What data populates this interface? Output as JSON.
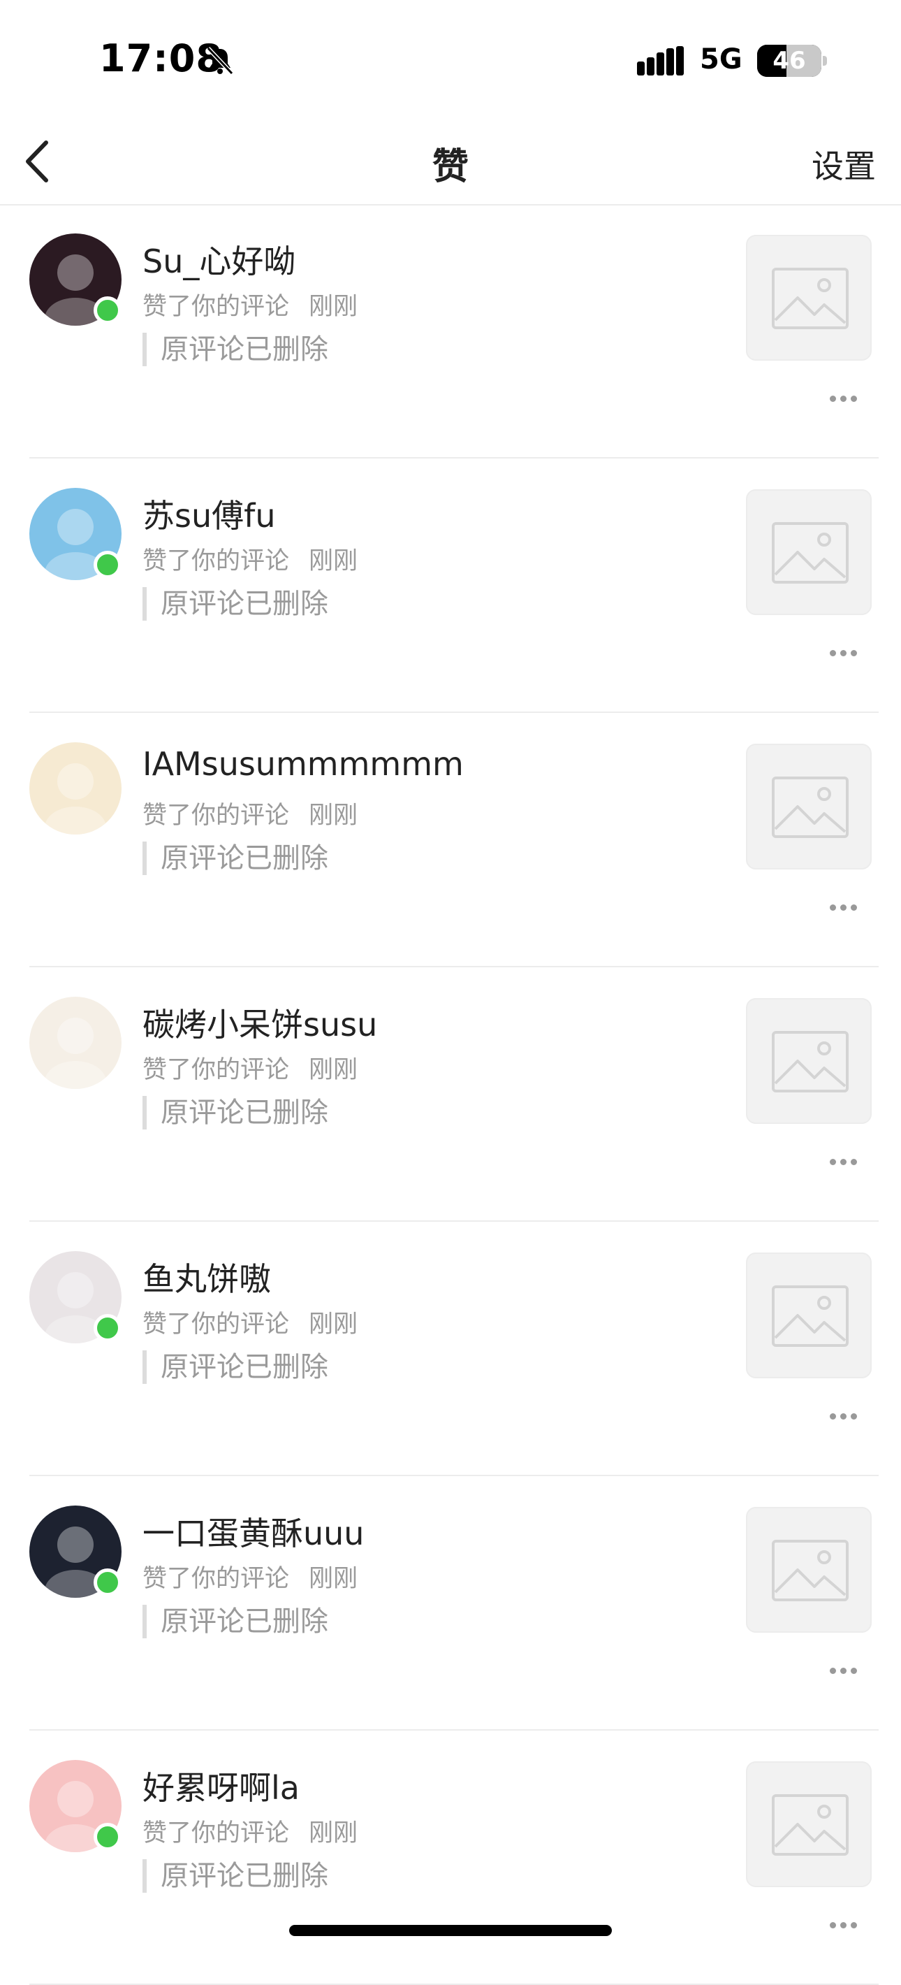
{
  "status_bar": {
    "time": "17:08",
    "network": "5G",
    "battery_percent": "46",
    "battery_level": 0.46,
    "icons": [
      "bell-slash-icon",
      "cellular-signal-icon",
      "battery-icon"
    ]
  },
  "nav": {
    "back_icon": "chevron-left-icon",
    "title": "赞",
    "settings_label": "设置"
  },
  "notifications": [
    {
      "name": "Su_心好呦",
      "action": "赞了你的评论",
      "time": "刚刚",
      "quote": "原评论已删除",
      "online": true,
      "avatar_color": "#2b1a22"
    },
    {
      "name": "苏su傅fu",
      "action": "赞了你的评论",
      "time": "刚刚",
      "quote": "原评论已删除",
      "online": true,
      "avatar_color": "#7fc2e8"
    },
    {
      "name": "IAMsusummmmmm",
      "action": "赞了你的评论",
      "time": "刚刚",
      "quote": "原评论已删除",
      "online": false,
      "avatar_color": "#f6ead2"
    },
    {
      "name": "碳烤小呆饼susu",
      "action": "赞了你的评论",
      "time": "刚刚",
      "quote": "原评论已删除",
      "online": false,
      "avatar_color": "#f5efe6"
    },
    {
      "name": "鱼丸饼嗷",
      "action": "赞了你的评论",
      "time": "刚刚",
      "quote": "原评论已删除",
      "online": true,
      "avatar_color": "#e9e4e6"
    },
    {
      "name": "一口蛋黄酥uuu",
      "action": "赞了你的评论",
      "time": "刚刚",
      "quote": "原评论已删除",
      "online": true,
      "avatar_color": "#1d2230"
    },
    {
      "name": "好累呀啊la",
      "action": "赞了你的评论",
      "time": "刚刚",
      "quote": "原评论已删除",
      "online": true,
      "avatar_color": "#f7c2c2"
    }
  ],
  "icons": {
    "thumbnail": "image-placeholder-icon",
    "more": "more-dots-icon"
  }
}
